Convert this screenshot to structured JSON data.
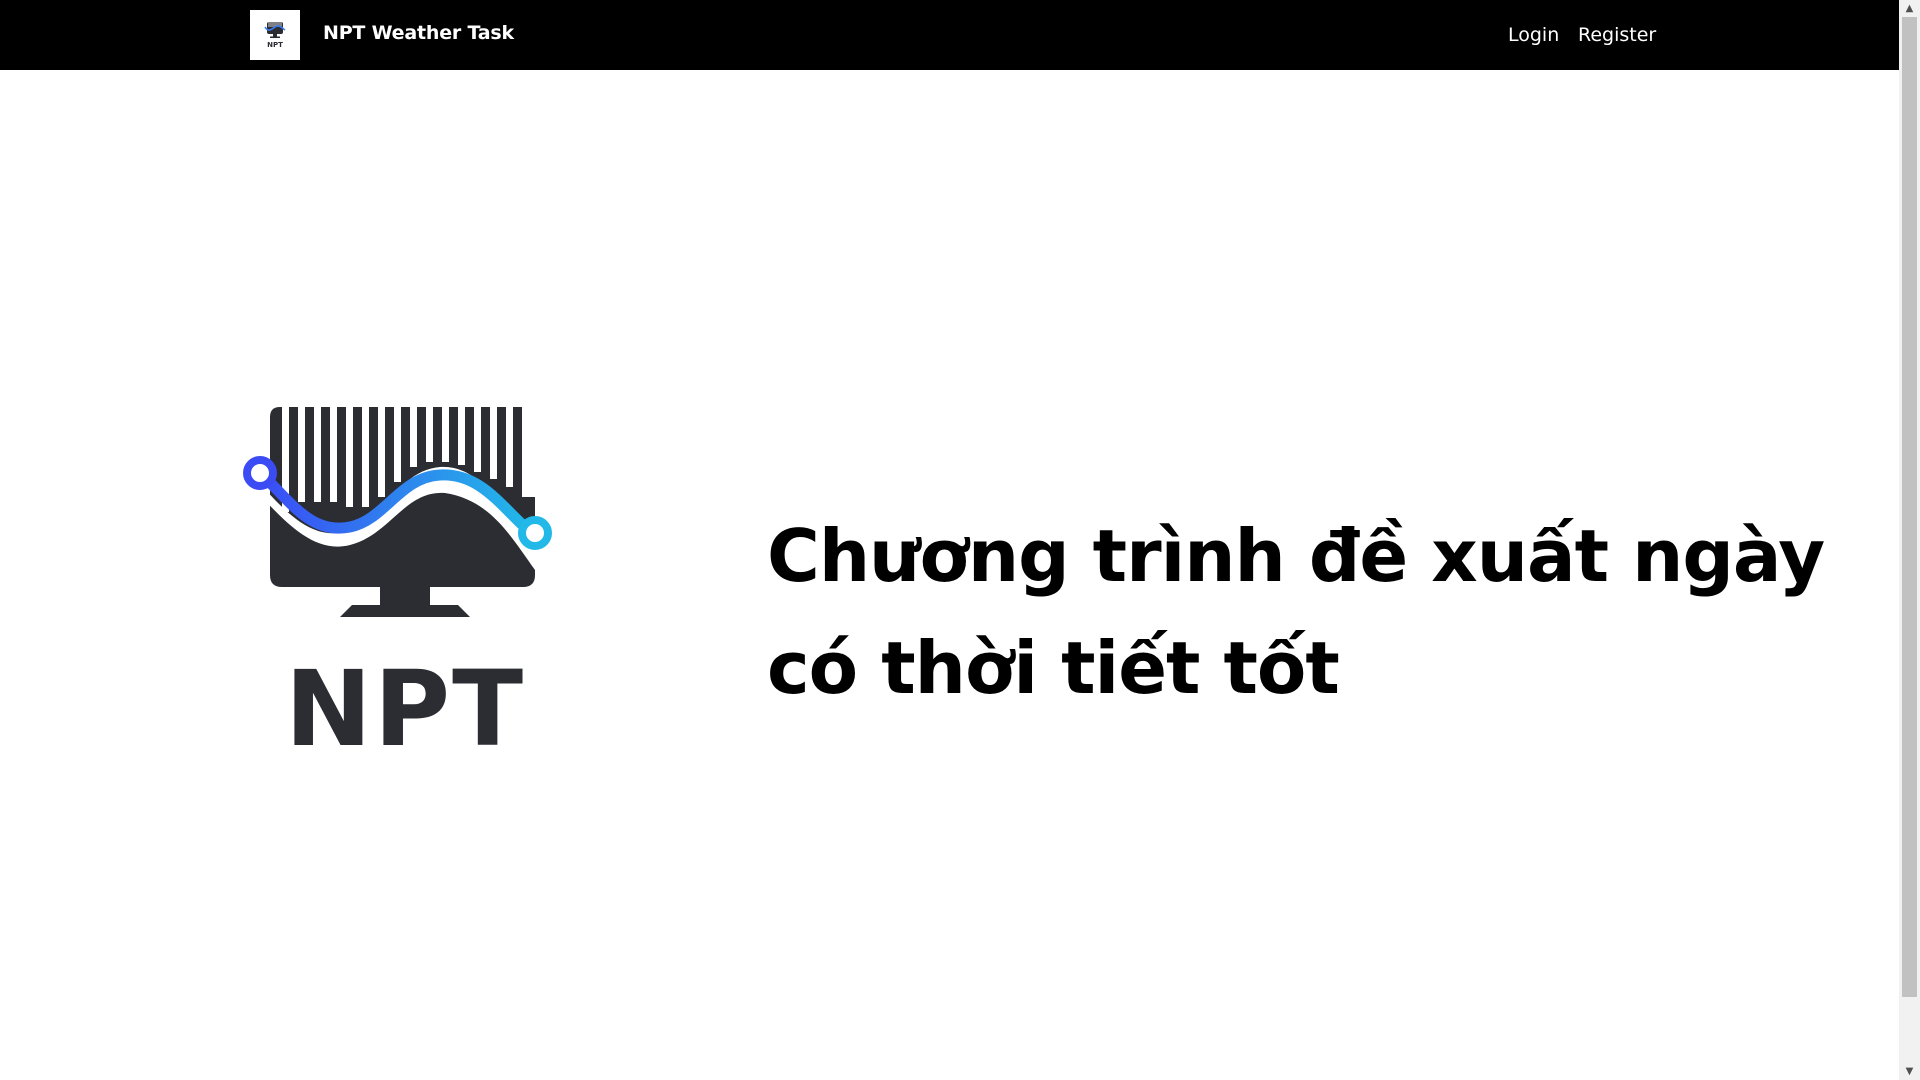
{
  "navbar": {
    "brand_title": "NPT Weather Task",
    "brand_logo_text": "NPT",
    "links": {
      "login": "Login",
      "register": "Register"
    },
    "background": "#000000"
  },
  "hero": {
    "logo_text": "NPT",
    "headline": "Chương trình đề xuất ngày có thời tiết tốt",
    "colors": {
      "logo_dark": "#2b2d33",
      "wave_blue_start": "#3b4cf5",
      "wave_blue_end": "#22b8e8"
    }
  },
  "scrollbar": {
    "up_icon": "scroll-up-arrow",
    "down_icon": "scroll-down-arrow"
  }
}
